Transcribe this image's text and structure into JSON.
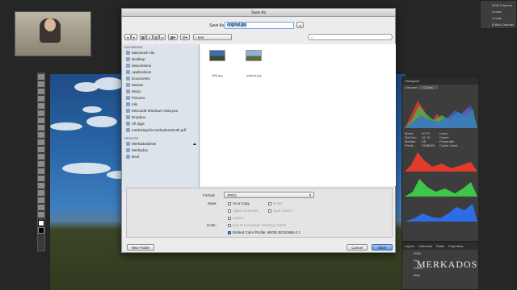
{
  "dialog": {
    "title": "Save As",
    "save_as_label": "Save As:",
    "filename": "original.jpg",
    "folder": "test",
    "search_placeholder": "",
    "new_folder_label": "New Folder",
    "cancel_label": "Cancel",
    "save_label": "Save"
  },
  "sidebar": {
    "favorites_header": "FAVORITES",
    "favorites": [
      "Macintosh HD",
      "Desktop",
      "alexcenteno",
      "Applications",
      "Documents",
      "Movies",
      "Music",
      "Pictures",
      "mls",
      "Microsoft Windows Vista.pvs",
      "Dropbox",
      "All Jpgs",
      "marketing-kit-merkados2013b.pdf"
    ],
    "devices_header": "DEVICES",
    "devices": [
      "MerkadosDrive",
      "Merkados",
      "Boot"
    ]
  },
  "files": [
    {
      "name": "Bild.jpg"
    },
    {
      "name": "original.jpg"
    }
  ],
  "options": {
    "format_label": "Format:",
    "format_value": "JPEG",
    "save_label": "Save:",
    "as_copy": "As a Copy",
    "notes": "Notes",
    "alpha_channels": "Alpha Channels",
    "spot_colors": "Spot Colors",
    "layers": "Layers",
    "color_label": "Color:",
    "use_proof": "Use Proof Setup:  Working CMYK",
    "embed_profile": "Embed Color Profile:  sRGB IEC61966-2.1"
  },
  "right_panel": {
    "items": [
      "RGB Channel",
      "Levels",
      "Levels",
      "B Bird Channel"
    ],
    "histogram_title": "Histogram",
    "channel_label": "Channel:",
    "channel_value": "Colors",
    "stats": [
      "Mean:",
      "Std Dev:",
      "Median:",
      "Pixels:"
    ],
    "stat_values": [
      "67.37",
      "61.75",
      "48",
      "5186605"
    ],
    "stats_right": [
      "Level:",
      "Count:",
      "Percentile:",
      "Cache Level:"
    ],
    "tab_labels": [
      "Layers",
      "Channels",
      "Paths",
      "Properties"
    ],
    "channels": [
      "RGB",
      "Red",
      "Green",
      "Blue"
    ],
    "watermark": "MERKADOS"
  },
  "colors": {
    "accent": "#3c7bd6",
    "dialog_bg": "#ececec",
    "sidebar_bg": "#dde3ea"
  }
}
